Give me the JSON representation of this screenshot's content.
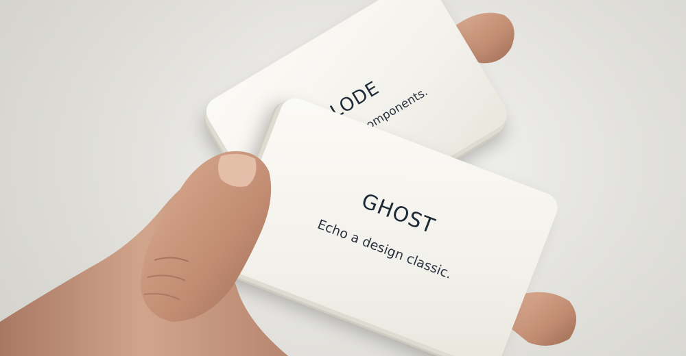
{
  "photo": {
    "subject": "hand holding two cards"
  },
  "cards": {
    "back": {
      "title": "EXPLODE",
      "description": "disorganised components."
    },
    "front": {
      "title": "GHOST",
      "description": "Echo a design classic."
    }
  },
  "colors": {
    "background": "#ecebe7",
    "card": "#f6f4ee",
    "ink": "#1e2b36",
    "skin": "#c99a80"
  }
}
